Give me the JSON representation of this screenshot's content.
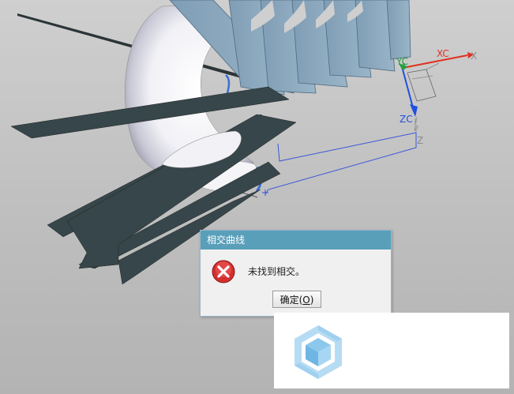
{
  "viewport": {
    "axis_labels": {
      "xc": "XC",
      "x": "X",
      "yc": "YC",
      "zc": "ZC",
      "z": "Z"
    }
  },
  "dialog": {
    "title": "相交曲线",
    "message": "未找到相交。",
    "ok_label": "确定",
    "ok_mnemonic": "O",
    "icon": "error-icon"
  },
  "colors": {
    "dialog_titlebar": "#5a9fba",
    "error_red": "#d32f2f",
    "sheet_dark": "#36464a",
    "sheet_blue": "#8aa8c0",
    "axis_red": "#e03020",
    "axis_green": "#22a040",
    "axis_blue": "#2050e0",
    "logo_blue": "#8cc8ec"
  },
  "white_panel": {
    "logo": "cube-logo-icon"
  }
}
